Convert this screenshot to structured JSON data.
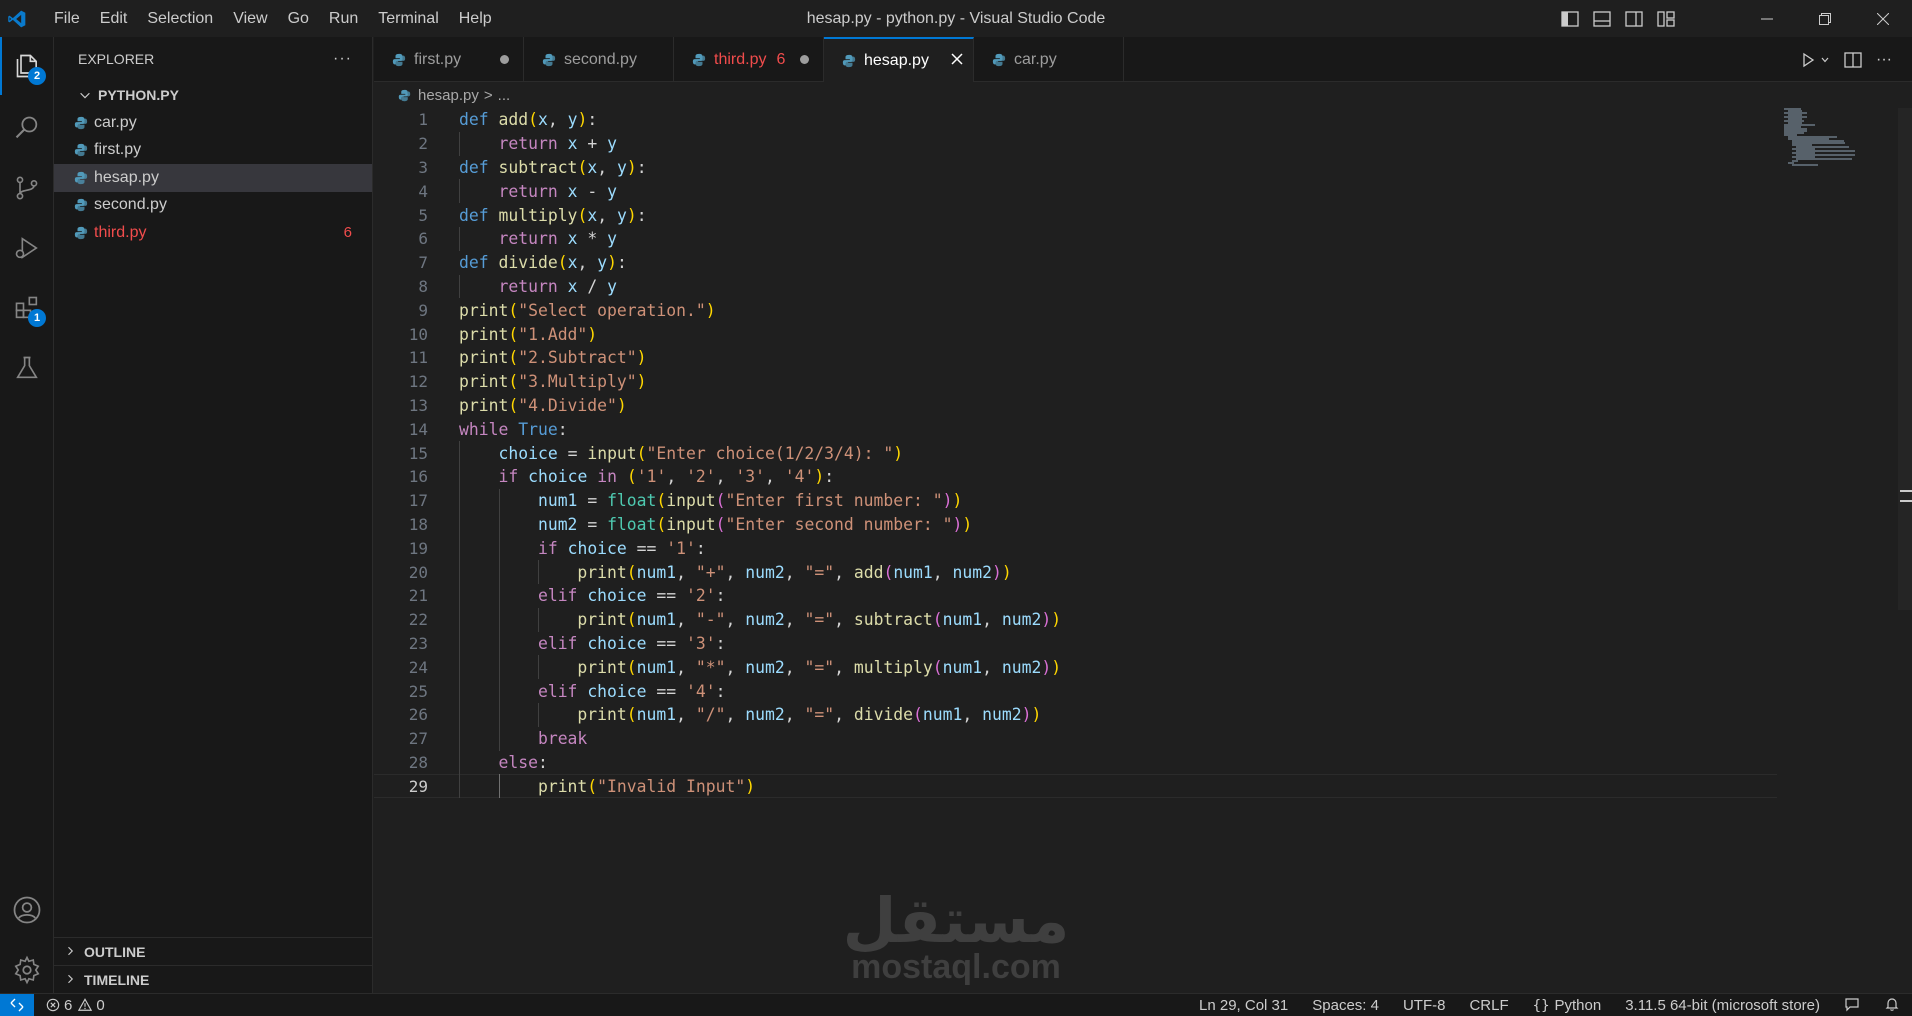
{
  "window": {
    "title": "hesap.py - python.py - Visual Studio Code",
    "menu": [
      "File",
      "Edit",
      "Selection",
      "View",
      "Go",
      "Run",
      "Terminal",
      "Help"
    ]
  },
  "activity_bar": {
    "explorer_badge": "2",
    "extensions_badge": "1"
  },
  "sidebar": {
    "header": "EXPLORER",
    "more": "···",
    "folder": "PYTHON.PY",
    "files": [
      {
        "name": "car.py",
        "errors": ""
      },
      {
        "name": "first.py",
        "errors": ""
      },
      {
        "name": "hesap.py",
        "errors": ""
      },
      {
        "name": "second.py",
        "errors": ""
      },
      {
        "name": "third.py",
        "errors": "6"
      }
    ],
    "outline": "OUTLINE",
    "timeline": "TIMELINE"
  },
  "tabs": [
    {
      "label": "first.py",
      "state": "dirty"
    },
    {
      "label": "second.py",
      "state": ""
    },
    {
      "label": "third.py",
      "state": "dirty",
      "errors": "6"
    },
    {
      "label": "hesap.py",
      "state": "active"
    },
    {
      "label": "car.py",
      "state": ""
    }
  ],
  "breadcrumb": {
    "file": "hesap.py",
    "sep": ">",
    "more": "..."
  },
  "code_lines": [
    "def add(x, y):",
    "    return x + y",
    "def subtract(x, y):",
    "    return x - y",
    "def multiply(x, y):",
    "    return x * y",
    "def divide(x, y):",
    "    return x / y",
    "print(\"Select operation.\")",
    "print(\"1.Add\")",
    "print(\"2.Subtract\")",
    "print(\"3.Multiply\")",
    "print(\"4.Divide\")",
    "while True:",
    "    choice = input(\"Enter choice(1/2/3/4): \")",
    "    if choice in ('1', '2', '3', '4'):",
    "        num1 = float(input(\"Enter first number: \"))",
    "        num2 = float(input(\"Enter second number: \"))",
    "        if choice == '1':",
    "            print(num1, \"+\", num2, \"=\", add(num1, num2))",
    "        elif choice == '2':",
    "            print(num1, \"-\", num2, \"=\", subtract(num1, num2))",
    "        elif choice == '3':",
    "            print(num1, \"*\", num2, \"=\", multiply(num1, num2))",
    "        elif choice == '4':",
    "            print(num1, \"/\", num2, \"=\", divide(num1, num2))",
    "        break",
    "    else:",
    "        print(\"Invalid Input\")"
  ],
  "current_line": 29,
  "watermark": {
    "arabic": "مستقل",
    "latin": "mostaql.com"
  },
  "status_bar": {
    "errors": "6",
    "warnings": "0",
    "position": "Ln 29, Col 31",
    "spaces": "Spaces: 4",
    "encoding": "UTF-8",
    "eol": "CRLF",
    "language": "Python",
    "interpreter": "3.11.5 64-bit (microsoft store)"
  },
  "colors": {
    "accent": "#0078d4",
    "error": "#f14c4c",
    "keyword": "#569cd6",
    "control": "#c586c0",
    "function": "#dcdcaa",
    "builtin": "#4ec9b0",
    "string": "#ce9178",
    "variable": "#9cdcfe"
  }
}
